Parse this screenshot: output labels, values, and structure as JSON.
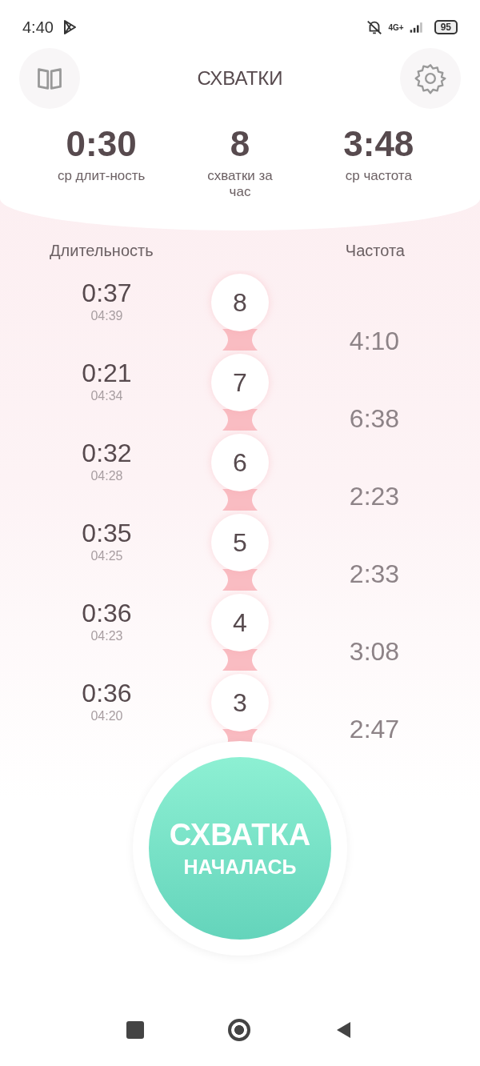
{
  "status_bar": {
    "time": "4:40",
    "network": "4G+",
    "battery": "95"
  },
  "header": {
    "title": "СХВАТКИ"
  },
  "stats": [
    {
      "value": "0:30",
      "label": "ср длит-ность"
    },
    {
      "value": "8",
      "label": "схватки за час"
    },
    {
      "value": "3:48",
      "label": "ср частота"
    }
  ],
  "columns": {
    "duration": "Длительность",
    "frequency": "Частота"
  },
  "contractions": [
    {
      "number": "8",
      "duration": "0:37",
      "start": "04:39",
      "frequency": "4:10"
    },
    {
      "number": "7",
      "duration": "0:21",
      "start": "04:34",
      "frequency": "6:38"
    },
    {
      "number": "6",
      "duration": "0:32",
      "start": "04:28",
      "frequency": "2:23"
    },
    {
      "number": "5",
      "duration": "0:35",
      "start": "04:25",
      "frequency": "2:33"
    },
    {
      "number": "4",
      "duration": "0:36",
      "start": "04:23",
      "frequency": "3:08"
    },
    {
      "number": "3",
      "duration": "0:36",
      "start": "04:20",
      "frequency": "2:47"
    }
  ],
  "start_button": {
    "line_1": "СХВАТКА",
    "line_2": "НАЧАЛАСЬ"
  }
}
